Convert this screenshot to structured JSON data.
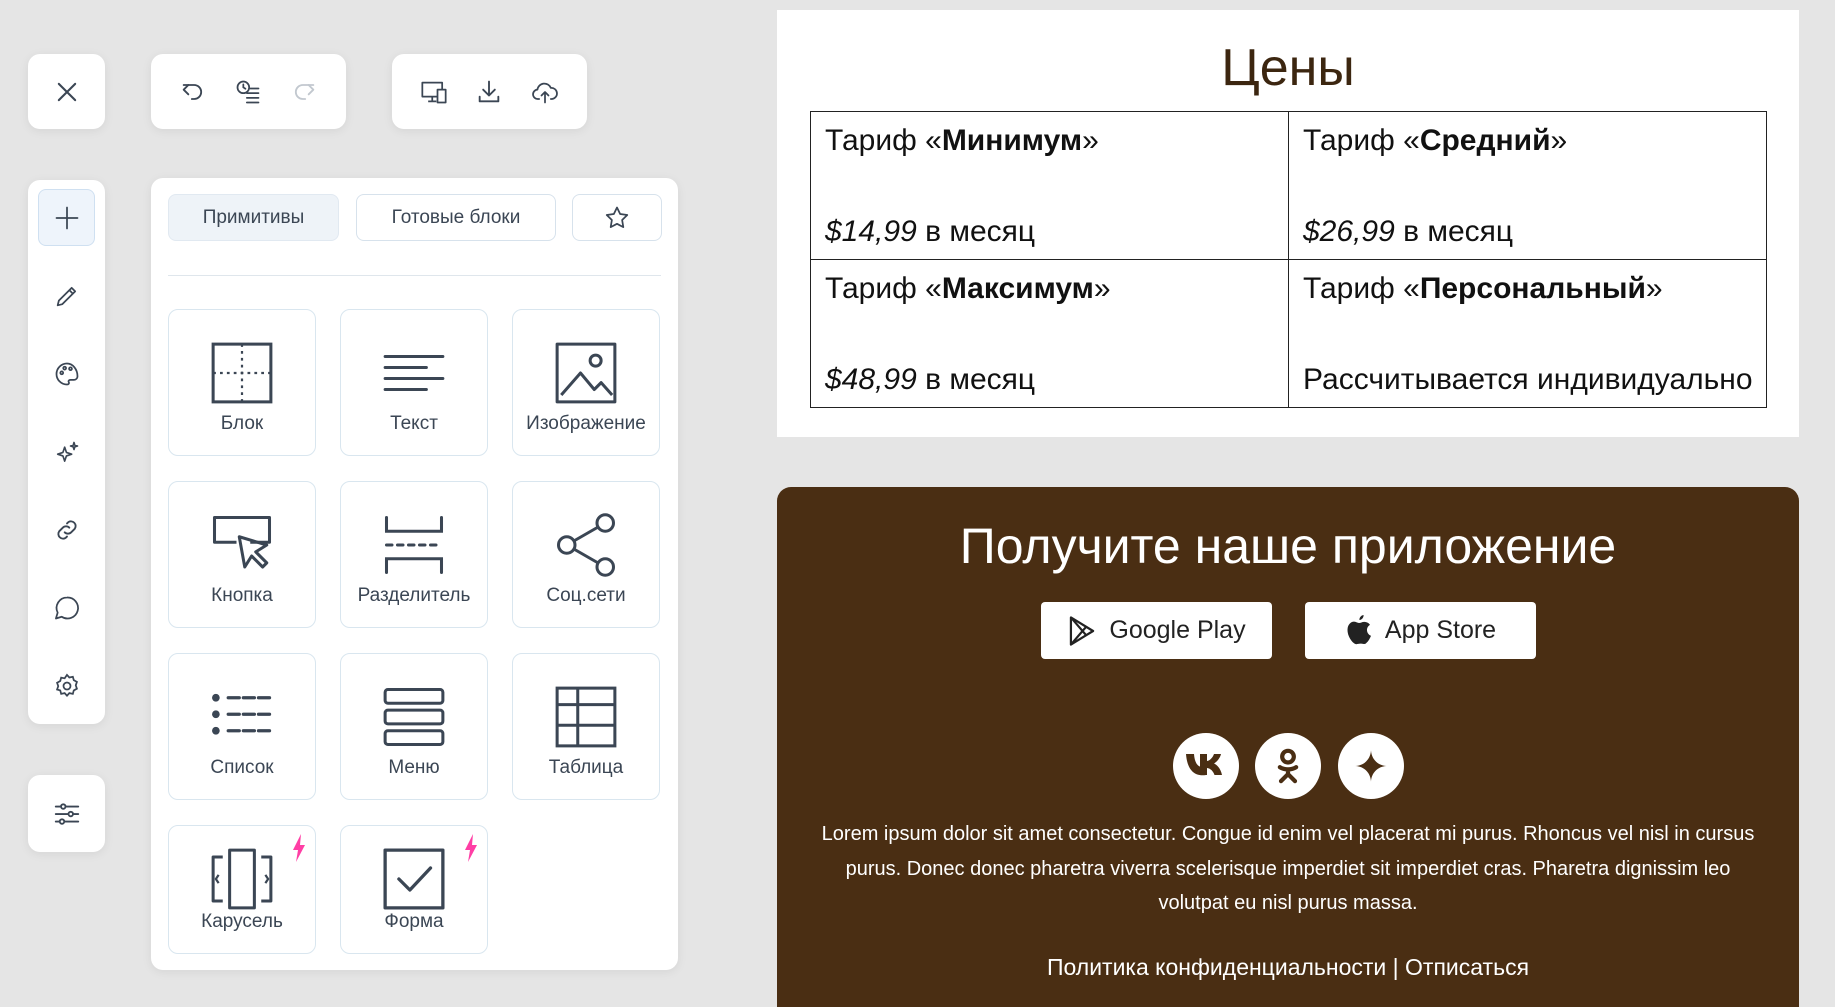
{
  "toolbar": {
    "close_icon": "close-icon",
    "history_icons": [
      "undo-icon",
      "history-icon",
      "redo-icon"
    ],
    "file_icons": [
      "preview-icon",
      "download-icon",
      "upload-icon"
    ]
  },
  "sidebar": {
    "items": [
      "add-icon",
      "pencil-icon",
      "palette-icon",
      "sparkles-icon",
      "link-icon",
      "comment-icon",
      "gear-icon"
    ],
    "bottom": "sliders-icon"
  },
  "panel": {
    "tabs": [
      {
        "label": "Примитивы",
        "active": true
      },
      {
        "label": "Готовые блоки",
        "active": false
      },
      {
        "label": "",
        "icon": "star-icon"
      }
    ],
    "tiles": [
      {
        "label": "Блок",
        "icon": "block-icon"
      },
      {
        "label": "Текст",
        "icon": "text-icon"
      },
      {
        "label": "Изображение",
        "icon": "image-icon"
      },
      {
        "label": "Кнопка",
        "icon": "button-icon"
      },
      {
        "label": "Разделитель",
        "icon": "divider-icon"
      },
      {
        "label": "Соц.сети",
        "icon": "share-icon"
      },
      {
        "label": "Список",
        "icon": "list-icon"
      },
      {
        "label": "Меню",
        "icon": "menu-icon"
      },
      {
        "label": "Таблица",
        "icon": "table-icon"
      },
      {
        "label": "Карусель",
        "icon": "carousel-icon",
        "badge": "bolt-icon"
      },
      {
        "label": "Форма",
        "icon": "form-icon",
        "badge": "bolt-icon"
      }
    ],
    "badge_color": "#ff3ea5"
  },
  "pricing": {
    "title": "Цены",
    "plans": [
      {
        "prefix": "Тариф «",
        "name": "Минимум",
        "suffix": "»",
        "price": "$14,99",
        "period": " в месяц"
      },
      {
        "prefix": "Тариф «",
        "name": "Средний",
        "suffix": "»",
        "price": "$26,99",
        "period": " в месяц"
      },
      {
        "prefix": "Тариф «",
        "name": "Максимум",
        "suffix": "»",
        "price": "$48,99",
        "period": " в месяц"
      },
      {
        "prefix": "Тариф «",
        "name": "Персональный",
        "suffix": "»",
        "price": "",
        "period": "Рассчитывается индивидуально"
      }
    ]
  },
  "app": {
    "title": "Получите наше приложение",
    "bg_color": "#4a2e13",
    "google_label": "Google Play",
    "apple_label": "App Store",
    "social": [
      "vk-icon",
      "ok-icon",
      "zen-icon"
    ],
    "lorem": "Lorem ipsum dolor sit amet consectetur. Congue id enim vel placerat mi purus. Rhoncus vel nisl in cursus purus. Donec donec pharetra viverra scelerisque imperdiet sit imperdiet cras. Pharetra dignissim leo volutpat eu nisl purus massa.",
    "privacy": "Политика конфиденциальности",
    "separator": " | ",
    "unsubscribe": "Отписаться"
  }
}
